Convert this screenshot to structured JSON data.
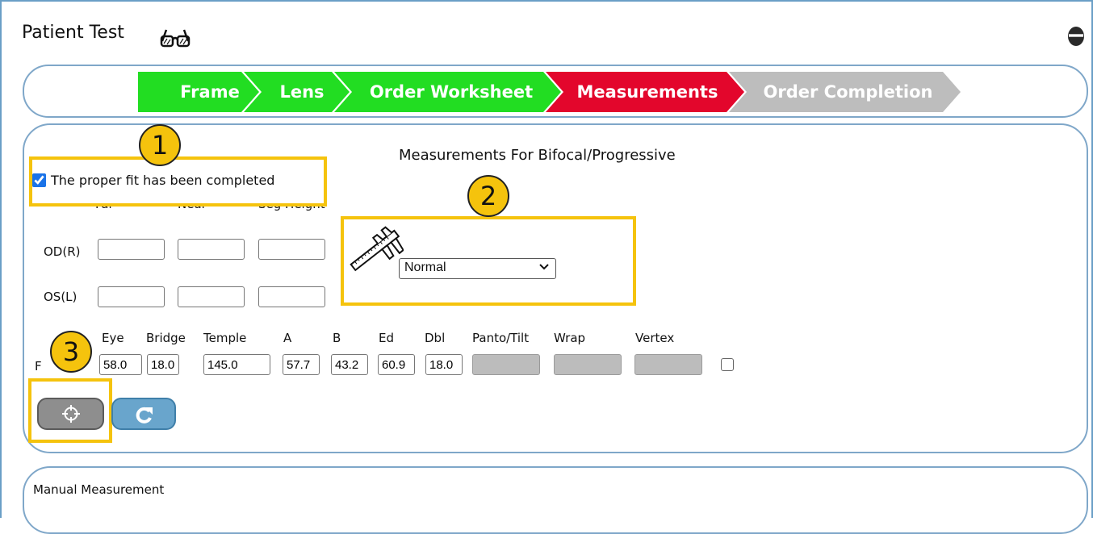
{
  "header": {
    "title": "Patient Test"
  },
  "steps": [
    {
      "label": "Frame",
      "status": "complete",
      "color": "#22dd22"
    },
    {
      "label": "Lens",
      "status": "complete",
      "color": "#22dd22"
    },
    {
      "label": "Order Worksheet",
      "status": "complete",
      "color": "#22dd22"
    },
    {
      "label": "Measurements",
      "status": "current",
      "color": "#e3062c"
    },
    {
      "label": "Order Completion",
      "status": "pending",
      "color": "#bdbdbd"
    }
  ],
  "callouts": [
    "1",
    "2",
    "3"
  ],
  "main": {
    "title": "Measurements For Bifocal/Progressive",
    "fit_label": "The proper fit has been completed",
    "fit_checked": true,
    "columns": [
      "Far",
      "Near",
      "Seg Height"
    ],
    "rows": [
      "OD(R)",
      "OS(L)"
    ],
    "fit_type": "Normal",
    "frame_labels": [
      "Eye",
      "Bridge",
      "Temple",
      "A",
      "B",
      "Ed",
      "Dbl",
      "Panto/Tilt",
      "Wrap",
      "Vertex"
    ],
    "frame_row_label": "F",
    "frame_values": [
      "58.0",
      "18.0",
      "145.0",
      "57.7",
      "43.2",
      "60.9",
      "18.0",
      "",
      "",
      ""
    ]
  },
  "manual": {
    "title": "Manual Measurement"
  },
  "icons": [
    "glasses-icon",
    "gear-icon",
    "caliper-icon",
    "crosshair-icon",
    "refresh-icon",
    "chevron-down-icon"
  ]
}
